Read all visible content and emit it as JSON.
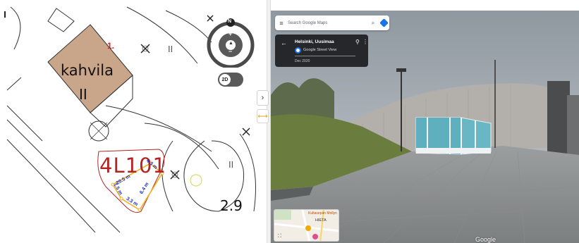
{
  "left_map": {
    "building_name": "kahvila",
    "building_floor": "II",
    "marker_number": "1.",
    "parcel_code": "4L101",
    "elevation": "2.9",
    "floor_mark_1": "II",
    "floor_mark_2": "II",
    "dimensions": [
      "4.3 m",
      "20.5 m",
      "1.5 m",
      "6.4 m",
      "3.3 m"
    ],
    "compass": {
      "north_label": "N",
      "zoom_in": "+",
      "zoom_out": "−"
    },
    "view_toggle": "2D"
  },
  "divider": {
    "collapse_icon": "›",
    "resize_icon": "⟷"
  },
  "street_view": {
    "search_placeholder": "Search Google Maps",
    "location_name": "Helsinki, Uusimaa",
    "imagery_source": "Google Street View",
    "capture_date": "Dec 2020",
    "minimap_label": "HIETA",
    "minimap_poi": "Kultasepän Mollyn",
    "watermark": "Google"
  },
  "colors": {
    "building_fill": "#c9a58a",
    "parcel_red": "#b22424",
    "dimension_blue": "#1c2fc4",
    "dimension_line": "#f2b020",
    "accent_blue": "#1a73e8"
  }
}
